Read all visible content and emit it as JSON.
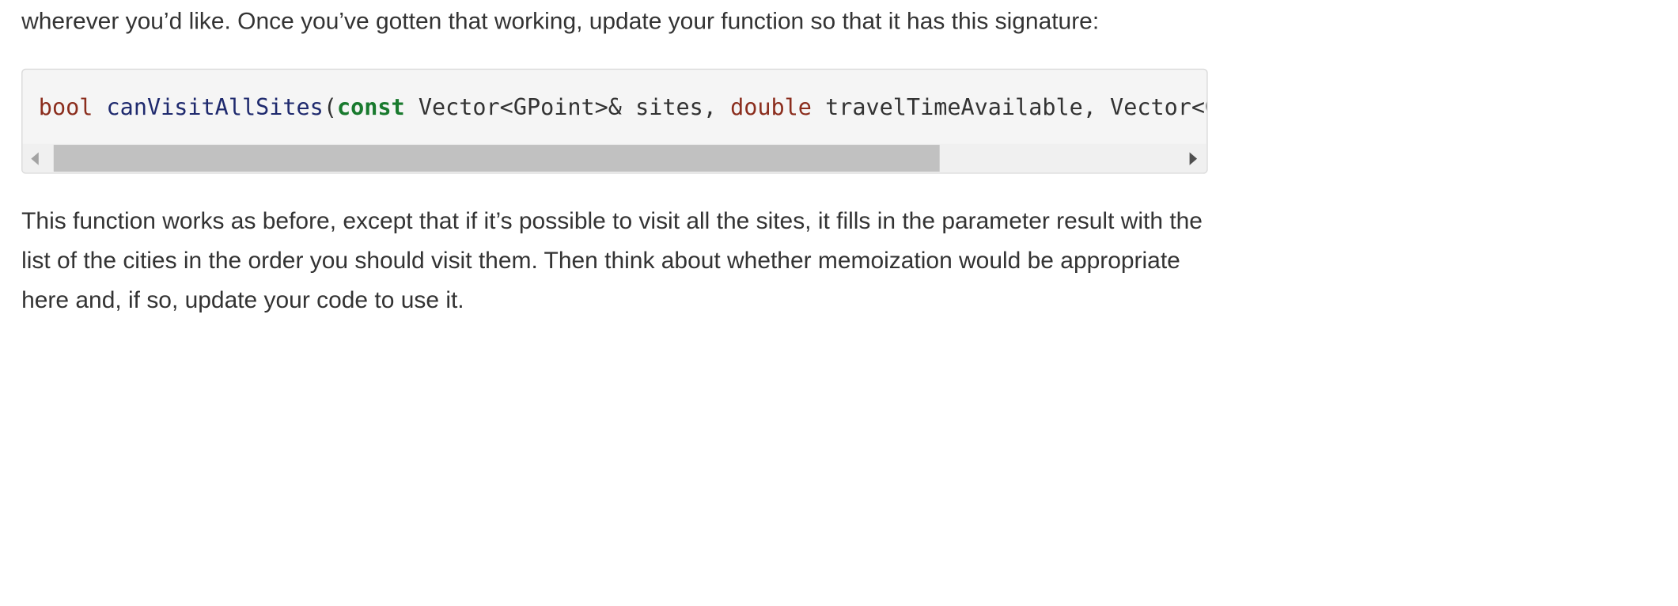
{
  "document": {
    "intro_text": "wherever you’d like. Once you’ve gotten that working, update your function so that it has this signature:",
    "code": {
      "return_type": "bool",
      "function_name": "canVisitAllSites",
      "open_paren": "(",
      "const_keyword": "const",
      "param1_type": " Vector<GPoint>& sites, ",
      "double_keyword": "double",
      "param2_rest": " travelTimeAvailable, Vector<GPoint>& result);"
    },
    "scrollbar": {
      "visible_fraction": 0.79
    },
    "body_text": "This function works as before, except that if it’s possible to visit all the sites, it fills in the parameter result with the list of the cities in the order you should visit them. Then think about whether memoization would be appropriate here and, if so, update your code to use it."
  }
}
